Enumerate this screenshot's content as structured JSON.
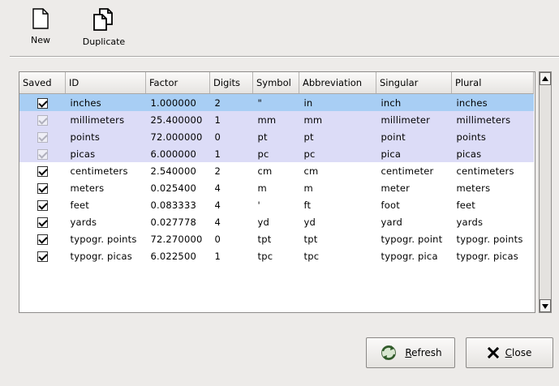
{
  "toolbar": {
    "new_label": "New",
    "duplicate_label": "Duplicate"
  },
  "table": {
    "columns": [
      "Saved",
      "ID",
      "Factor",
      "Digits",
      "Symbol",
      "Abbreviation",
      "Singular",
      "Plural"
    ],
    "rows": [
      {
        "saved": true,
        "saved_enabled": true,
        "state": "selected",
        "id": "inches",
        "factor": "1.000000",
        "digits": "2",
        "symbol": "\"",
        "abbreviation": "in",
        "singular": "inch",
        "plural": "inches"
      },
      {
        "saved": true,
        "saved_enabled": false,
        "state": "builtin",
        "id": "millimeters",
        "factor": "25.400000",
        "digits": "1",
        "symbol": "mm",
        "abbreviation": "mm",
        "singular": "millimeter",
        "plural": "millimeters"
      },
      {
        "saved": true,
        "saved_enabled": false,
        "state": "builtin",
        "id": "points",
        "factor": "72.000000",
        "digits": "0",
        "symbol": "pt",
        "abbreviation": "pt",
        "singular": "point",
        "plural": "points"
      },
      {
        "saved": true,
        "saved_enabled": false,
        "state": "builtin",
        "id": "picas",
        "factor": "6.000000",
        "digits": "1",
        "symbol": "pc",
        "abbreviation": "pc",
        "singular": "pica",
        "plural": "picas"
      },
      {
        "saved": true,
        "saved_enabled": true,
        "state": "normal",
        "id": "centimeters",
        "factor": "2.540000",
        "digits": "2",
        "symbol": "cm",
        "abbreviation": "cm",
        "singular": "centimeter",
        "plural": "centimeters"
      },
      {
        "saved": true,
        "saved_enabled": true,
        "state": "normal",
        "id": "meters",
        "factor": "0.025400",
        "digits": "4",
        "symbol": "m",
        "abbreviation": "m",
        "singular": "meter",
        "plural": "meters"
      },
      {
        "saved": true,
        "saved_enabled": true,
        "state": "normal",
        "id": "feet",
        "factor": "0.083333",
        "digits": "4",
        "symbol": "'",
        "abbreviation": "ft",
        "singular": "foot",
        "plural": "feet"
      },
      {
        "saved": true,
        "saved_enabled": true,
        "state": "normal",
        "id": "yards",
        "factor": "0.027778",
        "digits": "4",
        "symbol": "yd",
        "abbreviation": "yd",
        "singular": "yard",
        "plural": "yards"
      },
      {
        "saved": true,
        "saved_enabled": true,
        "state": "normal",
        "id": "typogr. points",
        "factor": "72.270000",
        "digits": "0",
        "symbol": "tpt",
        "abbreviation": "tpt",
        "singular": "typogr. point",
        "plural": "typogr. points"
      },
      {
        "saved": true,
        "saved_enabled": true,
        "state": "normal",
        "id": "typogr. picas",
        "factor": "6.022500",
        "digits": "1",
        "symbol": "tpc",
        "abbreviation": "tpc",
        "singular": "typogr. pica",
        "plural": "typogr. picas"
      }
    ]
  },
  "buttons": {
    "refresh": {
      "mnemonic": "R",
      "rest": "efresh",
      "icon": "refresh-icon"
    },
    "close": {
      "mnemonic": "C",
      "rest": "lose",
      "icon": "close-icon"
    }
  },
  "colors": {
    "selected_row": "#a8cef4",
    "builtin_row": "#dcdcf7",
    "window_bg": "#edebe9"
  }
}
